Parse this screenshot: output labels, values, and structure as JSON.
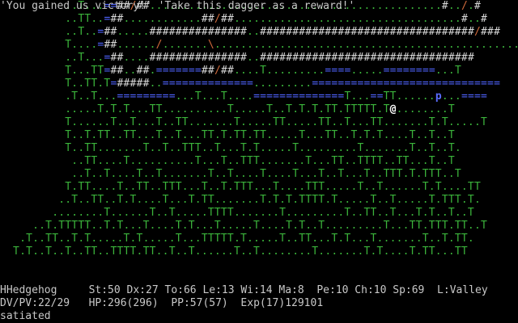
{
  "message": "'You gained us victory!' 'Take this dagger as a reward!'",
  "map_rows": [
    "          ..T...==##/##.............................................#../.#",
    "          ..TT..=##............##/##...................................#..#",
    "          ..T..=##.....###############..#################################/###",
    "          T....=##....../.......\\....................................................",
    "          ..T...=##....###############..#################################",
    "          T...TT=##..##.=======##/##....T.........====.....========...T",
    "          T..TT.T=#####..==============.........=============================",
    "          .T..T...=========...T...T....==============T...==TT......p...====",
    "          .....T.T.T...TT..........T.....T..T.T.T.TT.TTTTT.T@........T",
    "          T......T..T...T..TT.......T.....TT.....TT..T...TT.......T.T.....T",
    "          T..T.TT..TT...T..T...TT.T.TT.TT.....T...TT..T.T.T....T..T..T",
    "          T..TT.......T..T..TTT..T...T.T.....T.........T.......T..T..T.",
    "           ..TT....T..........T...T..TTT.......T...TT..TTTT..TT...T..T",
    "           ..T..T....T..T.......T..T....T....T...T..T...T..TTT.T.TTT..T",
    "          T.TT....T..TT..TTT...T..T.TTT...T....TTT.....T..T......T.T....TT",
    "         ..T..TT..T.T....T...T.TT.......T.T.T.TTTT.T.....T..T.....T.TTT.T.",
    "        ........T......T..T.....TTTT.......T.........T..TT..T...T.T..T..T",
    "     ..T.TTTTT..T.T...T....T.T...T.....T....T.T..T.........T...TT.TTT.TT..T",
    "   .T..TT..T.T.....T.T.....T...TTTTT.T.....T..TT...T.T...T.......T..T.TT.",
    "  T.T..T..T..TT..TTTT.TT..T..T......T..T........T.......T.T....T.TT...TT"
  ],
  "status": {
    "line1": "HHedgehog     St:50 Dx:27 To:66 Le:13 Wi:14 Ma:8  Pe:10 Ch:10 Sp:69  L:Valley",
    "line2": "DV/PV:22/29   HP:296(296)  PP:57(57)  Exp(17)129101",
    "line3": "satiated"
  },
  "colors": {
    "background": "#000000",
    "text": "#c8c8c8",
    "tree": "#3bb33b",
    "wall": "#d8d8d8",
    "water": "#4f64ff",
    "door": "#d06a3b",
    "player": "#ffffff",
    "monster": "#5a6cff"
  }
}
